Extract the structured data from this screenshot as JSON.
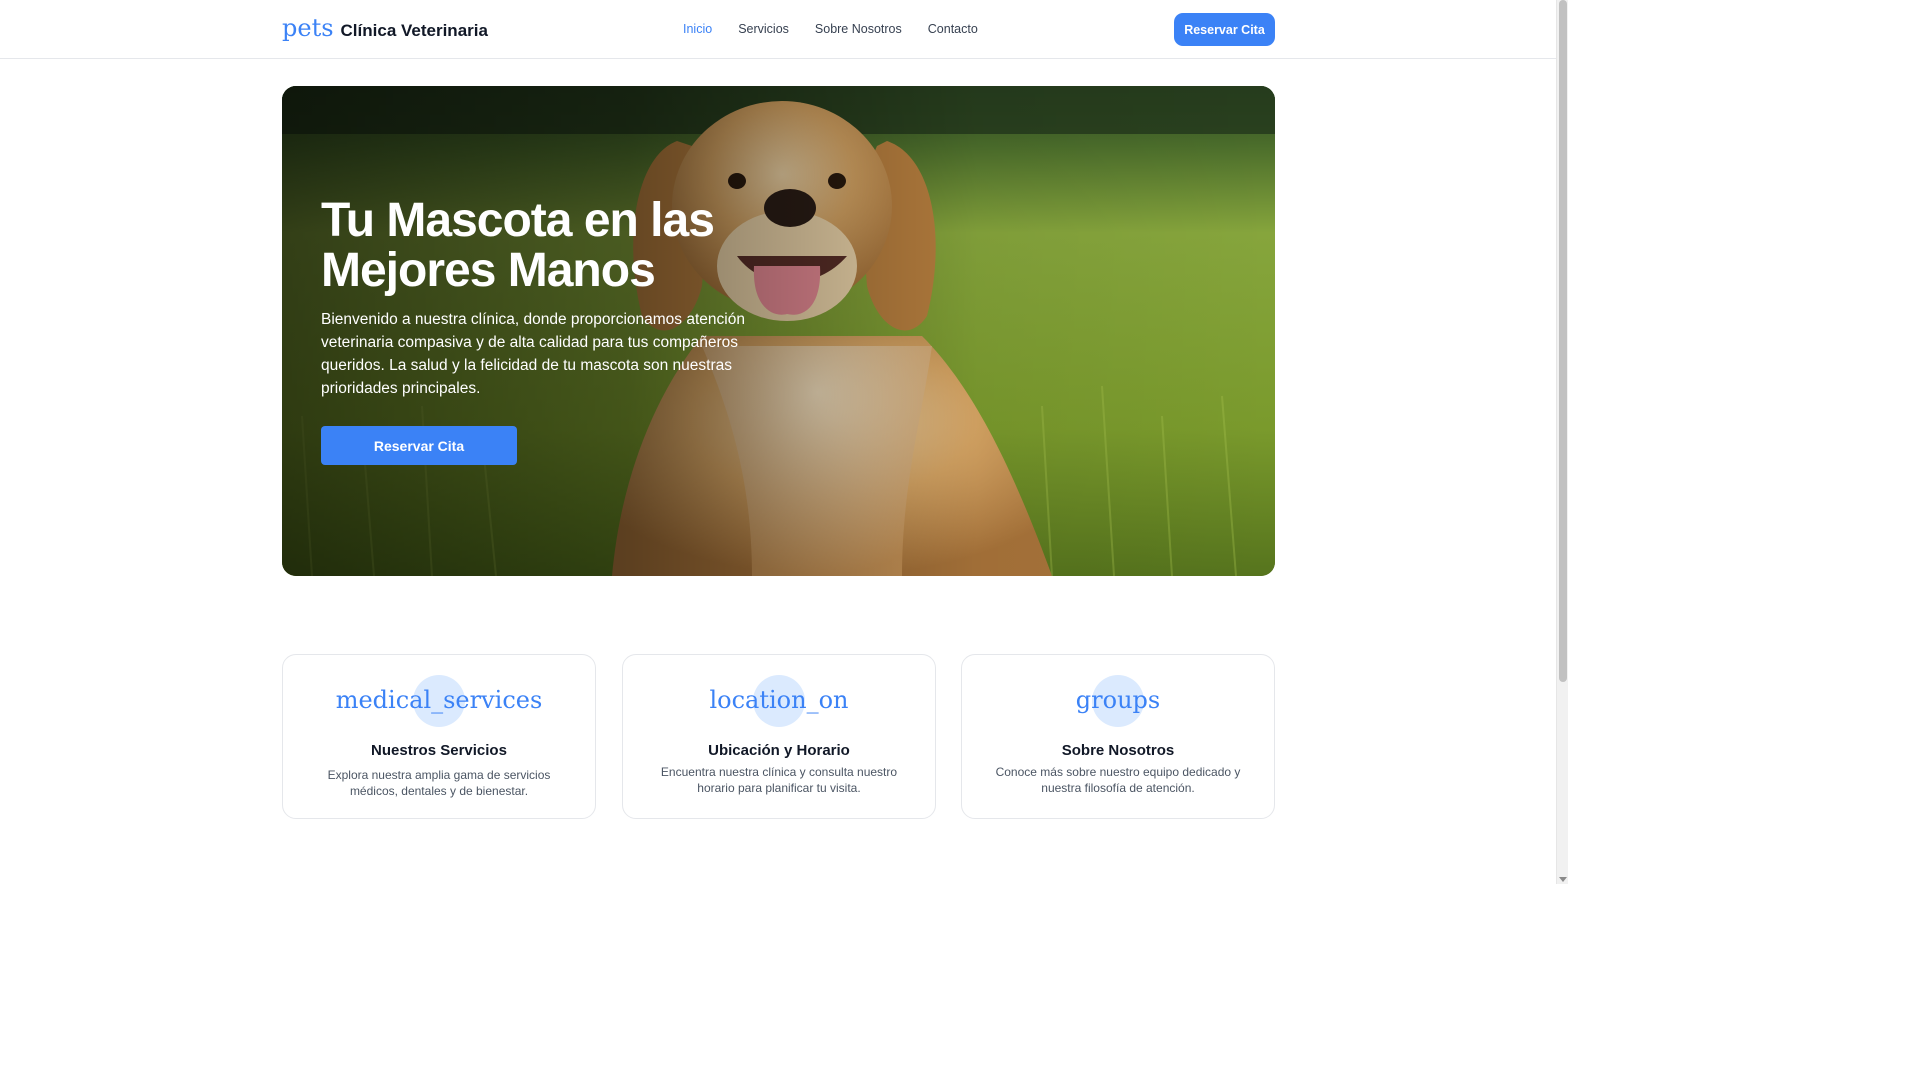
{
  "header": {
    "brand_icon": "pets",
    "brand_name": "Clínica Veterinaria",
    "nav": [
      {
        "label": "Inicio",
        "active": true
      },
      {
        "label": "Servicios",
        "active": false
      },
      {
        "label": "Sobre Nosotros",
        "active": false
      },
      {
        "label": "Contacto",
        "active": false
      }
    ],
    "cta_label": "Reservar Cita"
  },
  "hero": {
    "title": "Tu Mascota en las Mejores Manos",
    "text": "Bienvenido a nuestra clínica, donde proporcionamos atención veterinaria compasiva y de alta calidad para tus compañeros queridos. La salud y la felicidad de tu mascota son nuestras prioridades principales.",
    "cta_label": "Reservar Cita"
  },
  "cards": [
    {
      "icon": "medical_services",
      "title": "Nuestros Servicios",
      "description": "Explora nuestra amplia gama de servicios médicos, dentales y de bienestar."
    },
    {
      "icon": "location_on",
      "title": "Ubicación y Horario",
      "description": "Encuentra nuestra clínica y consulta nuestro horario para planificar tu visita."
    },
    {
      "icon": "groups",
      "title": "Sobre Nosotros",
      "description": "Conoce más sobre nuestro equipo dedicado y nuestra filosofía de atención."
    }
  ],
  "colors": {
    "accent": "#3b82f6",
    "icon_bg": "#dbeafe",
    "text_dark": "#111827",
    "text_muted": "#4b5563"
  }
}
